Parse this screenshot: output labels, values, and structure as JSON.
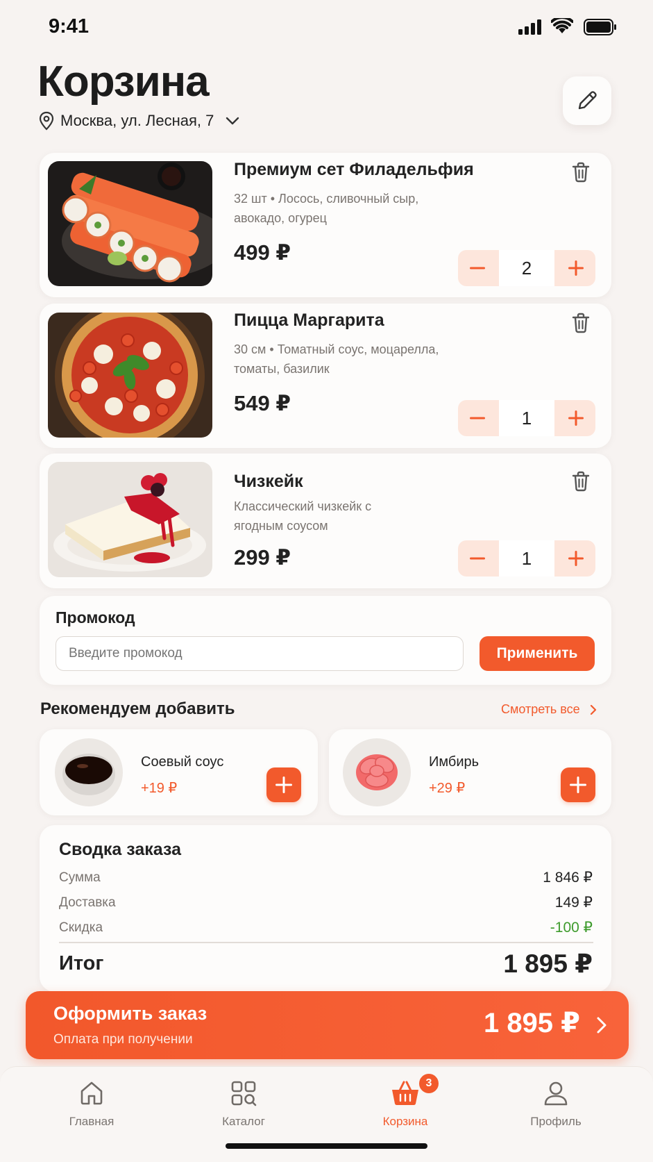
{
  "status_bar": {
    "time": "9:41"
  },
  "header": {
    "title": "Корзина",
    "address": "Москва, ул. Лесная, 7"
  },
  "cart": {
    "items": [
      {
        "title": "Премиум сет Филадельфия",
        "desc": "32 шт • Лосось, сливочный сыр, авокадо, огурец",
        "price": "499 ₽",
        "qty": "2"
      },
      {
        "title": "Пицца Маргарита",
        "desc": "30 см • Томатный соус, моцарелла, томаты, базилик",
        "price": "549 ₽",
        "qty": "1"
      },
      {
        "title": "Чизкейк",
        "desc": "Классический чизкейк с ягодным соусом",
        "price": "299 ₽",
        "qty": "1"
      }
    ]
  },
  "promo": {
    "title": "Промокод",
    "placeholder": "Введите промокод",
    "apply_label": "Применить"
  },
  "recommend": {
    "title": "Рекомендуем добавить",
    "see_all": "Смотреть все",
    "items": [
      {
        "name": "Соевый соус",
        "price": "+19 ₽"
      },
      {
        "name": "Имбирь",
        "price": "+29 ₽"
      }
    ]
  },
  "summary": {
    "title": "Сводка заказа",
    "rows": [
      {
        "label": "Сумма",
        "value": "1 846 ₽"
      },
      {
        "label": "Доставка",
        "value": "149 ₽"
      },
      {
        "label": "Скидка",
        "value": "-100 ₽"
      }
    ],
    "total_label": "Итог",
    "total_value": "1 895 ₽"
  },
  "checkout": {
    "label": "Оформить заказ",
    "sublabel": "Оплата при получении",
    "amount": "1 895 ₽"
  },
  "nav": {
    "items": [
      {
        "label": "Главная",
        "icon": "home-icon"
      },
      {
        "label": "Каталог",
        "icon": "catalog-icon"
      },
      {
        "label": "Корзина",
        "icon": "basket-icon",
        "badge": "3",
        "active": true
      },
      {
        "label": "Профиль",
        "icon": "profile-icon"
      }
    ]
  },
  "colors": {
    "accent": "#f25a2c",
    "discount": "#3e9b2c",
    "background": "#f7f3f1"
  }
}
